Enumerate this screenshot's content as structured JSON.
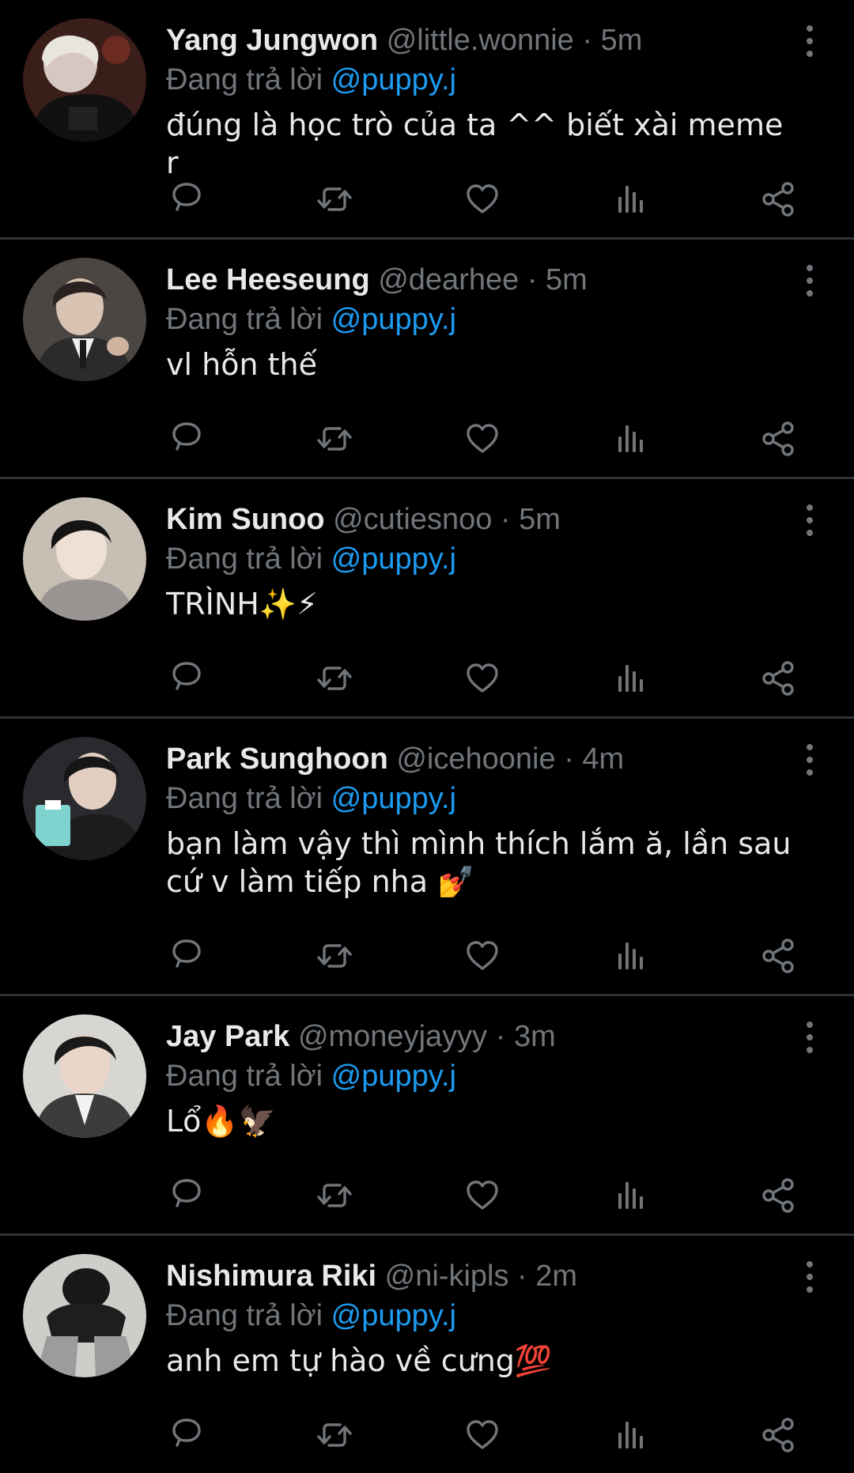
{
  "colors": {
    "background": "#000000",
    "primary_text": "#e7e9ea",
    "secondary_text": "#71767b",
    "mention": "#1d9bf0",
    "divider": "#2f3336"
  },
  "icons": {
    "reply": "speech-bubble-icon",
    "retweet": "retweet-arrows-icon",
    "like": "heart-icon",
    "views": "bar-chart-icon",
    "share": "share-nodes-icon",
    "more": "vertical-dots-icon"
  },
  "tweets": [
    {
      "name": "Yang Jungwon",
      "handle": "@little.wonnie",
      "dot": "·",
      "time": "5m",
      "reply_prefix": "Đang trả lời",
      "reply_to": "@puppy.j",
      "text": "đúng là học trò của ta ^^ biết xài meme r"
    },
    {
      "name": "Lee Heeseung",
      "handle": "@dearhee",
      "dot": "·",
      "time": "5m",
      "reply_prefix": "Đang trả lời",
      "reply_to": "@puppy.j",
      "text": "vl hỗn thế"
    },
    {
      "name": "Kim Sunoo",
      "handle": "@cutiesnoo",
      "dot": "·",
      "time": "5m",
      "reply_prefix": "Đang trả lời",
      "reply_to": "@puppy.j",
      "text": "TRÌNH✨⚡"
    },
    {
      "name": "Park Sunghoon",
      "handle": "@icehoonie",
      "dot": "·",
      "time": "4m",
      "reply_prefix": "Đang trả lời",
      "reply_to": "@puppy.j",
      "text": "bạn làm vậy thì mình thích lắm ă, lần sau cứ v làm tiếp nha 💅"
    },
    {
      "name": "Jay Park",
      "handle": "@moneyjayyy",
      "dot": "·",
      "time": "3m",
      "reply_prefix": "Đang trả lời",
      "reply_to": "@puppy.j",
      "text": "Lổ🔥🦅"
    },
    {
      "name": "Nishimura Riki",
      "handle": "@ni-kipls",
      "dot": "·",
      "time": "2m",
      "reply_prefix": "Đang trả lời",
      "reply_to": "@puppy.j",
      "text": "anh em tự hào về cưng💯"
    }
  ]
}
